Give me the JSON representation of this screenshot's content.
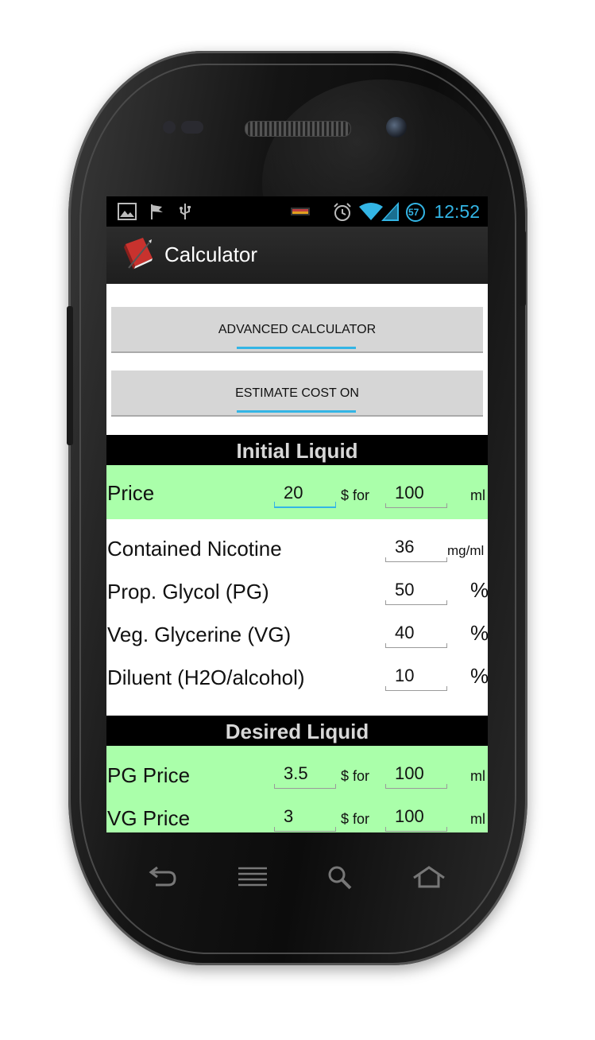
{
  "statusbar": {
    "left_icons": [
      "image-icon",
      "flag-icon",
      "usb-icon"
    ],
    "right_icons": [
      "battery-indicator-icon",
      "alarm-icon",
      "wifi-icon",
      "signal-icon",
      "speed-badge-icon"
    ],
    "badge_text": "57",
    "time": "12:52"
  },
  "actionbar": {
    "title": "Calculator",
    "icon": "book-icon"
  },
  "buttons": {
    "advanced": "ADVANCED CALCULATOR",
    "estimate": "ESTIMATE COST ON"
  },
  "initial": {
    "heading": "Initial Liquid",
    "price_label": "Price",
    "price_value": "20",
    "for_text": "$ for",
    "volume_value": "100",
    "volume_unit": "ml",
    "rows": [
      {
        "label": "Contained Nicotine",
        "value": "36",
        "unit": "mg/ml"
      },
      {
        "label": "Prop. Glycol (PG)",
        "value": "50",
        "unit": "%"
      },
      {
        "label": "Veg. Glycerine (VG)",
        "value": "40",
        "unit": "%"
      },
      {
        "label": "Diluent (H2O/alcohol)",
        "value": "10",
        "unit": "%"
      }
    ]
  },
  "desired": {
    "heading": "Desired Liquid",
    "rows": [
      {
        "label": "PG Price",
        "price": "3.5",
        "for_text": "$ for",
        "volume": "100",
        "unit": "ml"
      },
      {
        "label": "VG Price",
        "price": "3",
        "for_text": "$ for",
        "volume": "100",
        "unit": "ml"
      }
    ]
  },
  "navbar": [
    "back-icon",
    "menu-icon",
    "search-icon",
    "home-icon"
  ],
  "colors": {
    "accent": "#33b5e5",
    "green_row": "#aaffaa",
    "button_gray": "#d6d6d6"
  }
}
